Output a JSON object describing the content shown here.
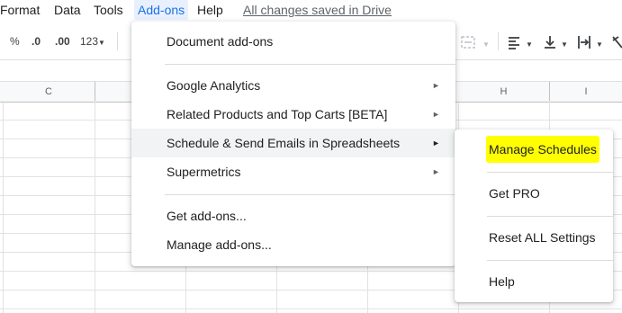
{
  "menubar": {
    "items": [
      "Format",
      "Data",
      "Tools",
      "Add-ons",
      "Help"
    ],
    "active_item": "Add-ons",
    "drive_status": "All changes saved in Drive"
  },
  "toolbar": {
    "percent_label": "%",
    "decrease_decimal_label": ".0",
    "increase_decimal_label": ".00",
    "more_formats_label": "123"
  },
  "columns": [
    "C",
    "H",
    "I"
  ],
  "addons_menu": {
    "items": [
      {
        "label": "Document add-ons",
        "has_submenu": false
      },
      {
        "label": "Google Analytics",
        "has_submenu": true
      },
      {
        "label": "Related Products and Top Carts [BETA]",
        "has_submenu": true
      },
      {
        "label": "Schedule & Send Emails in Spreadsheets",
        "has_submenu": true
      },
      {
        "label": "Supermetrics",
        "has_submenu": true
      },
      {
        "label": "Get add-ons...",
        "has_submenu": false
      },
      {
        "label": "Manage add-ons...",
        "has_submenu": false
      }
    ],
    "submenu_arrow": "►"
  },
  "schedule_submenu": {
    "items": [
      {
        "label": "Manage Schedules",
        "highlighted": true
      },
      {
        "label": "Get PRO",
        "highlighted": false
      },
      {
        "label": "Reset ALL Settings",
        "highlighted": false
      },
      {
        "label": "Help",
        "highlighted": false
      }
    ]
  },
  "colors": {
    "highlight": "#ffff00",
    "menu_hover": "#f1f3f4",
    "active_menu_bg": "#e8f0fe",
    "active_menu_text": "#1a73e8"
  }
}
